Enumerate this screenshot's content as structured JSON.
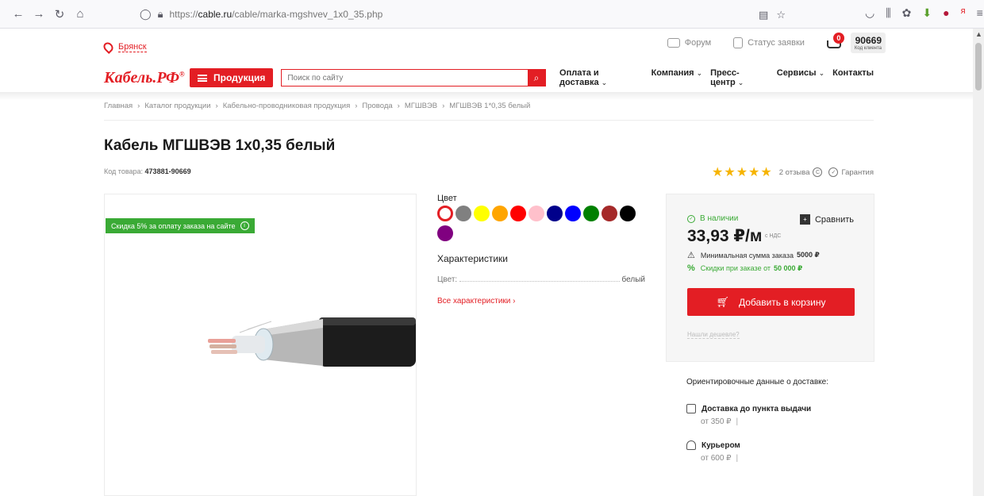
{
  "browser": {
    "url_prefix": "https://",
    "url_domain": "cable.ru",
    "url_path": "/cable/marka-mgshvev_1x0_35.php"
  },
  "header": {
    "city": "Брянск",
    "forum": "Форум",
    "order_status": "Статус заявки",
    "cart_count": "0",
    "client_code": "90669",
    "client_code_label": "Код клиента",
    "logo": "Кабель.РФ",
    "products_button": "Продукция",
    "search_placeholder": "Поиск по сайту",
    "nav": [
      {
        "label": "Оплата и доставка",
        "chevron": true
      },
      {
        "label": "Компания",
        "chevron": true
      },
      {
        "label": "Пресс-центр",
        "chevron": true
      },
      {
        "label": "Сервисы",
        "chevron": true
      },
      {
        "label": "Контакты",
        "chevron": false
      }
    ]
  },
  "breadcrumb": [
    "Главная",
    "Каталог продукции",
    "Кабельно-проводниковая продукция",
    "Провода",
    "МГШВЭВ",
    "МГШВЭВ 1*0,35 белый"
  ],
  "product": {
    "title": "Кабель МГШВЭВ 1х0,35 белый",
    "sku_label": "Код товара:",
    "sku": "473881-90669",
    "reviews": "2 отзыва",
    "guarantee": "Гарантия",
    "rating": 5,
    "promo": "Скидка 5% за оплату заказа на сайте"
  },
  "colors": {
    "label": "Цвет",
    "swatches": [
      "#ffffff",
      "#808080",
      "#ffff00",
      "#ffa500",
      "#ff0000",
      "#ffc0cb",
      "#00008b",
      "#0000ff",
      "#008000",
      "#a52a2a",
      "#000000",
      "#800080"
    ],
    "selected": 0
  },
  "characteristics": {
    "title": "Характеристики",
    "rows": [
      {
        "name": "Цвет:",
        "value": "белый"
      }
    ],
    "all_link": "Все характеристики ›"
  },
  "buy": {
    "stock": "В наличии",
    "compare": "Сравнить",
    "price": "33,93 ₽/м",
    "vat": "с НДС",
    "min_order_label": "Минимальная сумма заказа",
    "min_order_value": "5000 ₽",
    "discount_label": "Скидки при заказе от",
    "discount_value": "50 000 ₽",
    "add_to_cart": "Добавить в корзину",
    "cheaper": "Нашли дешевле?"
  },
  "delivery": {
    "title": "Ориентировочные данные о доставке:",
    "options": [
      {
        "name": "Доставка до пункта выдачи",
        "price": "от 350 ₽"
      },
      {
        "name": "Курьером",
        "price": "от 600 ₽"
      }
    ]
  }
}
